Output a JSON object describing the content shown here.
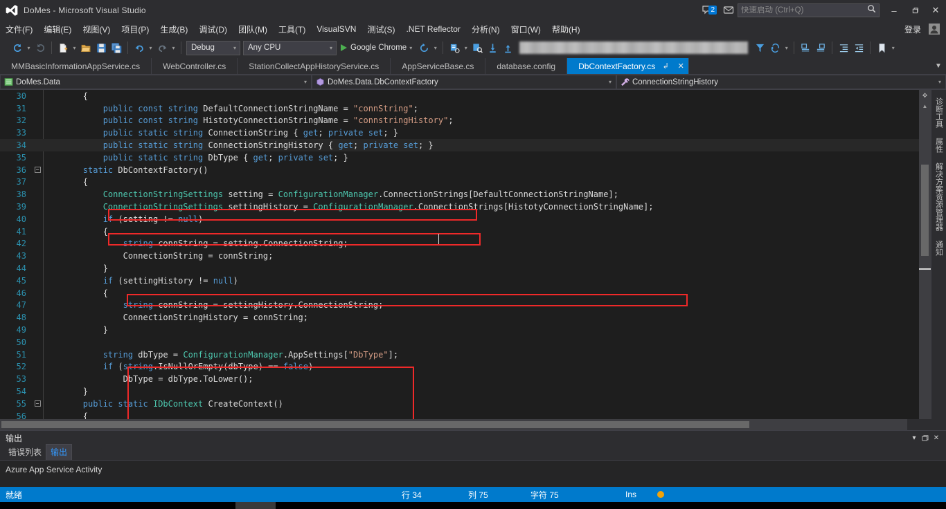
{
  "titlebar": {
    "logo_icon": "visual-studio-logo",
    "title": "DoMes - Microsoft Visual Studio",
    "notification_count": "2",
    "feedback_icon": "feedback-icon",
    "search_placeholder": "快速启动 (Ctrl+Q)",
    "search_value": "",
    "search_icon": "search-icon",
    "minimize": "–",
    "maximize": "❐",
    "close": "✕"
  },
  "menubar": {
    "items": [
      {
        "label": "文件(F)"
      },
      {
        "label": "编辑(E)"
      },
      {
        "label": "视图(V)"
      },
      {
        "label": "项目(P)"
      },
      {
        "label": "生成(B)"
      },
      {
        "label": "调试(D)"
      },
      {
        "label": "团队(M)"
      },
      {
        "label": "工具(T)"
      },
      {
        "label": "VisualSVN"
      },
      {
        "label": "测试(S)"
      },
      {
        "label": ".NET Reflector"
      },
      {
        "label": "分析(N)"
      },
      {
        "label": "窗口(W)"
      },
      {
        "label": "帮助(H)"
      }
    ],
    "signin_label": "登录",
    "account_icon": "account-icon"
  },
  "toolbar": {
    "navigate_back_icon": "navigate-back-icon",
    "navigate_forward_icon": "navigate-forward-icon",
    "new_project_icon": "new-project-icon",
    "open_file_icon": "open-file-icon",
    "save_icon": "save-icon",
    "save_all_icon": "save-all-icon",
    "undo_icon": "undo-icon",
    "redo_icon": "redo-icon",
    "config_value": "Debug",
    "platform_value": "Any CPU",
    "run_target_label": "Google Chrome",
    "refresh_icon": "refresh-icon",
    "step_icon": "step-into-icon",
    "search_blur_placeholder": "",
    "find_icon": "find-icon",
    "step_over_icon": "step-over-icon",
    "step_out_icon": "step-out-icon",
    "comment_icon": "comment-icon",
    "uncomment_icon": "uncomment-icon",
    "indent_icon": "increase-indent-icon",
    "outdent_icon": "decrease-indent-icon",
    "bookmark_icon": "bookmark-icon"
  },
  "tabs": {
    "items": [
      {
        "label": "MMBasicInformationAppService.cs",
        "active": false
      },
      {
        "label": "WebController.cs",
        "active": false
      },
      {
        "label": "StationCollectAppHistoryService.cs",
        "active": false
      },
      {
        "label": "AppServiceBase.cs",
        "active": false
      },
      {
        "label": "database.config",
        "active": false
      },
      {
        "label": "DbContextFactory.cs",
        "active": true
      }
    ],
    "pin_icon": "↲",
    "close_icon": "✕",
    "overflow_icon": "▼"
  },
  "navbar": {
    "project_icon": "project-icon",
    "project": "DoMes.Data",
    "class_icon": "class-icon",
    "class": "DoMes.Data.DbContextFactory",
    "member_icon": "method-icon",
    "member": "ConnectionStringHistory",
    "dropdown_icon": "▾"
  },
  "editor": {
    "current_line": 34,
    "lines": [
      {
        "n": 30,
        "fold": "",
        "tokens": [
          [
            "ws",
            "        "
          ],
          [
            "op",
            "{"
          ]
        ]
      },
      {
        "n": 31,
        "fold": "",
        "tokens": [
          [
            "ws",
            "            "
          ],
          [
            "kw",
            "public"
          ],
          [
            "ws",
            " "
          ],
          [
            "kw",
            "const"
          ],
          [
            "ws",
            " "
          ],
          [
            "kw",
            "string"
          ],
          [
            "ws",
            " "
          ],
          [
            "id",
            "DefaultConnectionStringName"
          ],
          [
            "ws",
            " "
          ],
          [
            "op",
            "="
          ],
          [
            "ws",
            " "
          ],
          [
            "str",
            "\"connString\""
          ],
          [
            "op",
            ";"
          ]
        ]
      },
      {
        "n": 32,
        "fold": "",
        "tokens": [
          [
            "ws",
            "            "
          ],
          [
            "kw",
            "public"
          ],
          [
            "ws",
            " "
          ],
          [
            "kw",
            "const"
          ],
          [
            "ws",
            " "
          ],
          [
            "kw",
            "string"
          ],
          [
            "ws",
            " "
          ],
          [
            "id",
            "HistotyConnectionStringName"
          ],
          [
            "ws",
            " "
          ],
          [
            "op",
            "="
          ],
          [
            "ws",
            " "
          ],
          [
            "str",
            "\"connstringHistory\""
          ],
          [
            "op",
            ";"
          ]
        ]
      },
      {
        "n": 33,
        "fold": "",
        "tokens": [
          [
            "ws",
            "            "
          ],
          [
            "kw",
            "public"
          ],
          [
            "ws",
            " "
          ],
          [
            "kw",
            "static"
          ],
          [
            "ws",
            " "
          ],
          [
            "kw",
            "string"
          ],
          [
            "ws",
            " "
          ],
          [
            "id",
            "ConnectionString"
          ],
          [
            "ws",
            " "
          ],
          [
            "op",
            "{ "
          ],
          [
            "kw",
            "get"
          ],
          [
            "op",
            "; "
          ],
          [
            "kw",
            "private"
          ],
          [
            "ws",
            " "
          ],
          [
            "kw",
            "set"
          ],
          [
            "op",
            "; }"
          ]
        ]
      },
      {
        "n": 34,
        "fold": "",
        "tokens": [
          [
            "ws",
            "            "
          ],
          [
            "kw",
            "public"
          ],
          [
            "ws",
            " "
          ],
          [
            "kw",
            "static"
          ],
          [
            "ws",
            " "
          ],
          [
            "kw",
            "string"
          ],
          [
            "ws",
            " "
          ],
          [
            "id",
            "ConnectionStringHistory"
          ],
          [
            "ws",
            " "
          ],
          [
            "op",
            "{ "
          ],
          [
            "kw",
            "get"
          ],
          [
            "op",
            "; "
          ],
          [
            "kw",
            "private"
          ],
          [
            "ws",
            " "
          ],
          [
            "kw",
            "set"
          ],
          [
            "op",
            "; }"
          ]
        ]
      },
      {
        "n": 35,
        "fold": "",
        "tokens": [
          [
            "ws",
            "            "
          ],
          [
            "kw",
            "public"
          ],
          [
            "ws",
            " "
          ],
          [
            "kw",
            "static"
          ],
          [
            "ws",
            " "
          ],
          [
            "kw",
            "string"
          ],
          [
            "ws",
            " "
          ],
          [
            "id",
            "DbType"
          ],
          [
            "ws",
            " "
          ],
          [
            "op",
            "{ "
          ],
          [
            "kw",
            "get"
          ],
          [
            "op",
            "; "
          ],
          [
            "kw",
            "private"
          ],
          [
            "ws",
            " "
          ],
          [
            "kw",
            "set"
          ],
          [
            "op",
            "; }"
          ]
        ]
      },
      {
        "n": 36,
        "fold": "minus",
        "tokens": [
          [
            "ws",
            "        "
          ],
          [
            "kw",
            "static"
          ],
          [
            "ws",
            " "
          ],
          [
            "id",
            "DbContextFactory"
          ],
          [
            "op",
            "()"
          ]
        ]
      },
      {
        "n": 37,
        "fold": "",
        "tokens": [
          [
            "ws",
            "        "
          ],
          [
            "op",
            "{"
          ]
        ]
      },
      {
        "n": 38,
        "fold": "",
        "tokens": [
          [
            "ws",
            "            "
          ],
          [
            "cls",
            "ConnectionStringSettings"
          ],
          [
            "ws",
            " "
          ],
          [
            "id",
            "setting"
          ],
          [
            "ws",
            " "
          ],
          [
            "op",
            "= "
          ],
          [
            "cls",
            "ConfigurationManager"
          ],
          [
            "op",
            "."
          ],
          [
            "id",
            "ConnectionStrings"
          ],
          [
            "op",
            "["
          ],
          [
            "id",
            "DefaultConnectionStringName"
          ],
          [
            "op",
            "];"
          ]
        ]
      },
      {
        "n": 39,
        "fold": "",
        "tokens": [
          [
            "ws",
            "            "
          ],
          [
            "cls",
            "ConnectionStringSettings"
          ],
          [
            "ws",
            " "
          ],
          [
            "id",
            "settingHistory"
          ],
          [
            "ws",
            " "
          ],
          [
            "op",
            "= "
          ],
          [
            "cls",
            "ConfigurationManager"
          ],
          [
            "op",
            "."
          ],
          [
            "id",
            "ConnectionStrings"
          ],
          [
            "op",
            "["
          ],
          [
            "id",
            "HistotyConnectionStringName"
          ],
          [
            "op",
            "];"
          ]
        ]
      },
      {
        "n": 40,
        "fold": "",
        "tokens": [
          [
            "ws",
            "            "
          ],
          [
            "kw",
            "if"
          ],
          [
            "ws",
            " "
          ],
          [
            "op",
            "("
          ],
          [
            "id",
            "setting"
          ],
          [
            "ws",
            " "
          ],
          [
            "op",
            "!= "
          ],
          [
            "kw",
            "null"
          ],
          [
            "op",
            ")"
          ]
        ]
      },
      {
        "n": 41,
        "fold": "",
        "tokens": [
          [
            "ws",
            "            "
          ],
          [
            "op",
            "{"
          ]
        ]
      },
      {
        "n": 42,
        "fold": "",
        "tokens": [
          [
            "ws",
            "                "
          ],
          [
            "kw",
            "string"
          ],
          [
            "ws",
            " "
          ],
          [
            "id",
            "connString"
          ],
          [
            "ws",
            " "
          ],
          [
            "op",
            "= "
          ],
          [
            "id",
            "setting"
          ],
          [
            "op",
            "."
          ],
          [
            "id",
            "ConnectionString"
          ],
          [
            "op",
            ";"
          ]
        ]
      },
      {
        "n": 43,
        "fold": "",
        "tokens": [
          [
            "ws",
            "                "
          ],
          [
            "id",
            "ConnectionString"
          ],
          [
            "ws",
            " "
          ],
          [
            "op",
            "= "
          ],
          [
            "id",
            "connString"
          ],
          [
            "op",
            ";"
          ]
        ]
      },
      {
        "n": 44,
        "fold": "",
        "tokens": [
          [
            "ws",
            "            "
          ],
          [
            "op",
            "}"
          ]
        ]
      },
      {
        "n": 45,
        "fold": "",
        "tokens": [
          [
            "ws",
            "            "
          ],
          [
            "kw",
            "if"
          ],
          [
            "ws",
            " "
          ],
          [
            "op",
            "("
          ],
          [
            "id",
            "settingHistory"
          ],
          [
            "ws",
            " "
          ],
          [
            "op",
            "!= "
          ],
          [
            "kw",
            "null"
          ],
          [
            "op",
            ")"
          ]
        ]
      },
      {
        "n": 46,
        "fold": "",
        "tokens": [
          [
            "ws",
            "            "
          ],
          [
            "op",
            "{"
          ]
        ]
      },
      {
        "n": 47,
        "fold": "",
        "tokens": [
          [
            "ws",
            "                "
          ],
          [
            "kw",
            "string"
          ],
          [
            "ws",
            " "
          ],
          [
            "id",
            "connString"
          ],
          [
            "ws",
            " "
          ],
          [
            "op",
            "= "
          ],
          [
            "id",
            "settingHistory"
          ],
          [
            "op",
            "."
          ],
          [
            "id",
            "ConnectionString"
          ],
          [
            "op",
            ";"
          ]
        ]
      },
      {
        "n": 48,
        "fold": "",
        "tokens": [
          [
            "ws",
            "                "
          ],
          [
            "id",
            "ConnectionStringHistory"
          ],
          [
            "ws",
            " "
          ],
          [
            "op",
            "= "
          ],
          [
            "id",
            "connString"
          ],
          [
            "op",
            ";"
          ]
        ]
      },
      {
        "n": 49,
        "fold": "",
        "tokens": [
          [
            "ws",
            "            "
          ],
          [
            "op",
            "}"
          ]
        ]
      },
      {
        "n": 50,
        "fold": "",
        "tokens": []
      },
      {
        "n": 51,
        "fold": "",
        "tokens": [
          [
            "ws",
            "            "
          ],
          [
            "kw",
            "string"
          ],
          [
            "ws",
            " "
          ],
          [
            "id",
            "dbType"
          ],
          [
            "ws",
            " "
          ],
          [
            "op",
            "= "
          ],
          [
            "cls",
            "ConfigurationManager"
          ],
          [
            "op",
            "."
          ],
          [
            "id",
            "AppSettings"
          ],
          [
            "op",
            "["
          ],
          [
            "str",
            "\"DbType\""
          ],
          [
            "op",
            "];"
          ]
        ]
      },
      {
        "n": 52,
        "fold": "",
        "tokens": [
          [
            "ws",
            "            "
          ],
          [
            "kw",
            "if"
          ],
          [
            "ws",
            " "
          ],
          [
            "op",
            "("
          ],
          [
            "kw",
            "string"
          ],
          [
            "op",
            "."
          ],
          [
            "id",
            "IsNullOrEmpty"
          ],
          [
            "op",
            "("
          ],
          [
            "id",
            "dbType"
          ],
          [
            "op",
            ") == "
          ],
          [
            "kw",
            "false"
          ],
          [
            "op",
            ")"
          ]
        ]
      },
      {
        "n": 53,
        "fold": "",
        "tokens": [
          [
            "ws",
            "                "
          ],
          [
            "id",
            "DbType"
          ],
          [
            "ws",
            " "
          ],
          [
            "op",
            "= "
          ],
          [
            "id",
            "dbType"
          ],
          [
            "op",
            "."
          ],
          [
            "id",
            "ToLower"
          ],
          [
            "op",
            "();"
          ]
        ]
      },
      {
        "n": 54,
        "fold": "",
        "tokens": [
          [
            "ws",
            "        "
          ],
          [
            "op",
            "}"
          ]
        ]
      },
      {
        "n": 55,
        "fold": "minus",
        "tokens": [
          [
            "ws",
            "        "
          ],
          [
            "kw",
            "public"
          ],
          [
            "ws",
            " "
          ],
          [
            "kw",
            "static"
          ],
          [
            "ws",
            " "
          ],
          [
            "cls",
            "IDbContext"
          ],
          [
            "ws",
            " "
          ],
          [
            "id",
            "CreateContext"
          ],
          [
            "op",
            "()"
          ]
        ]
      },
      {
        "n": 56,
        "fold": "",
        "tokens": [
          [
            "ws",
            "        "
          ],
          [
            "op",
            "{"
          ]
        ]
      }
    ],
    "highlights": [
      {
        "name": "annotation-line-32"
      },
      {
        "name": "annotation-line-34"
      },
      {
        "name": "annotation-line-39"
      },
      {
        "name": "annotation-block-45-49"
      }
    ],
    "accent_red": "#ef2929",
    "background": "#1e1e1e"
  },
  "right_tabs": {
    "items": [
      {
        "label": "诊断工具"
      },
      {
        "label": "属性"
      },
      {
        "label": "解决方案资源管理器"
      },
      {
        "label": "通知"
      }
    ]
  },
  "output": {
    "title": "输出",
    "dropdown_icon": "▾",
    "float_icon": "❐",
    "close_icon": "✕",
    "tabs": [
      {
        "label": "错误列表",
        "selected": false
      },
      {
        "label": "输出",
        "selected": true
      }
    ],
    "content": "Azure App Service Activity"
  },
  "statusbar": {
    "ready": "就绪",
    "line_label": "行 34",
    "col_label": "列 75",
    "char_label": "字符 75",
    "insert_mode": "Ins",
    "indicator_color": "#f0a30a",
    "background": "#007acc"
  }
}
